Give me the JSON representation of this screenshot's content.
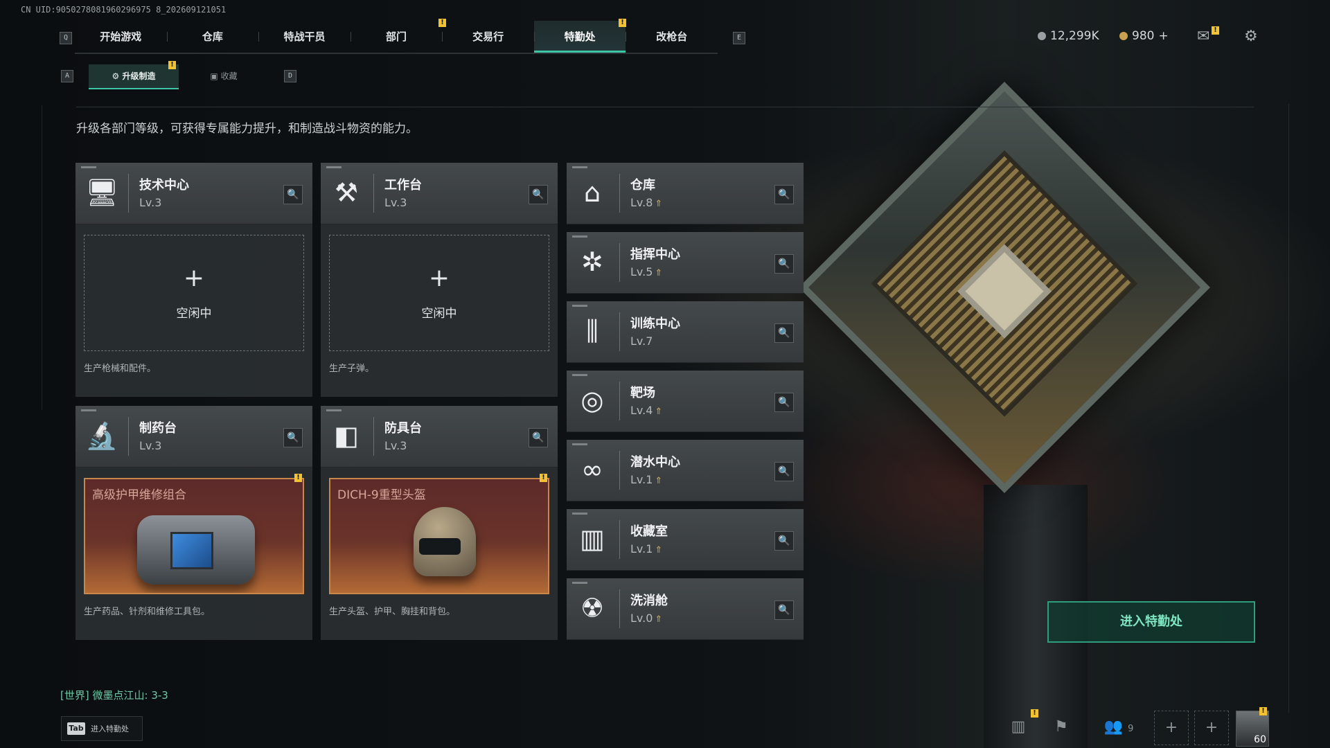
{
  "uid": "CN UID:9050278081960296975 8_202609121051",
  "keys": {
    "prev_tab": "Q",
    "next_tab": "E",
    "prev_sub": "A",
    "next_sub": "D",
    "tab_key": "Tab"
  },
  "topnav": {
    "tabs": [
      {
        "label": "开始游戏"
      },
      {
        "label": "仓库"
      },
      {
        "label": "特战干员"
      },
      {
        "label": "部门"
      },
      {
        "label": "交易行"
      },
      {
        "label": "特勤处"
      },
      {
        "label": "改枪台"
      }
    ],
    "active_index": 5
  },
  "currency": {
    "silver": "12,299K",
    "gold": "980",
    "gold_plus": "+"
  },
  "subtabs": [
    {
      "label": "升级制造"
    },
    {
      "label": "收藏"
    }
  ],
  "description": "升级各部门等级，可获得专属能力提升，和制造战斗物资的能力。",
  "workshops": [
    {
      "name": "技术中心",
      "level": "Lv.3",
      "icon": "computer-icon",
      "slot_text": "空闲中",
      "note": "生产枪械和配件。"
    },
    {
      "name": "工作台",
      "level": "Lv.3",
      "icon": "tools-icon",
      "slot_text": "空闲中",
      "note": "生产子弹。"
    },
    {
      "name": "制药台",
      "level": "Lv.3",
      "icon": "microscope-icon",
      "item": "高级护甲维修组合",
      "note": "生产药品、针剂和维修工具包。"
    },
    {
      "name": "防具台",
      "level": "Lv.3",
      "icon": "blocks-icon",
      "item": "DICH-9重型头盔",
      "note": "生产头盔、护甲、胸挂和背包。"
    }
  ],
  "departments": [
    {
      "name": "仓库",
      "level": "Lv.8",
      "upgradable": true,
      "icon": "warehouse-icon"
    },
    {
      "name": "指挥中心",
      "level": "Lv.5",
      "upgradable": true,
      "icon": "command-icon"
    },
    {
      "name": "训练中心",
      "level": "Lv.7",
      "upgradable": false,
      "icon": "dumbbell-icon"
    },
    {
      "name": "靶场",
      "level": "Lv.4",
      "upgradable": true,
      "icon": "target-icon"
    },
    {
      "name": "潜水中心",
      "level": "Lv.1",
      "upgradable": true,
      "icon": "diving-mask-icon"
    },
    {
      "name": "收藏室",
      "level": "Lv.1",
      "upgradable": true,
      "icon": "vault-icon"
    },
    {
      "name": "洗消舱",
      "level": "Lv.0",
      "upgradable": true,
      "icon": "radiation-icon"
    }
  ],
  "enter_button": "进入特勤处",
  "chat": {
    "channel": "[世界]",
    "text": "微墨点江山: 3-3"
  },
  "tab_hint": "进入特勤处",
  "bottom": {
    "friends_count": "9",
    "player_level": "60"
  },
  "colors": {
    "accent": "#3ec7a6",
    "badge": "#f2c230",
    "upgrade_arrow": "#c8a86a"
  }
}
